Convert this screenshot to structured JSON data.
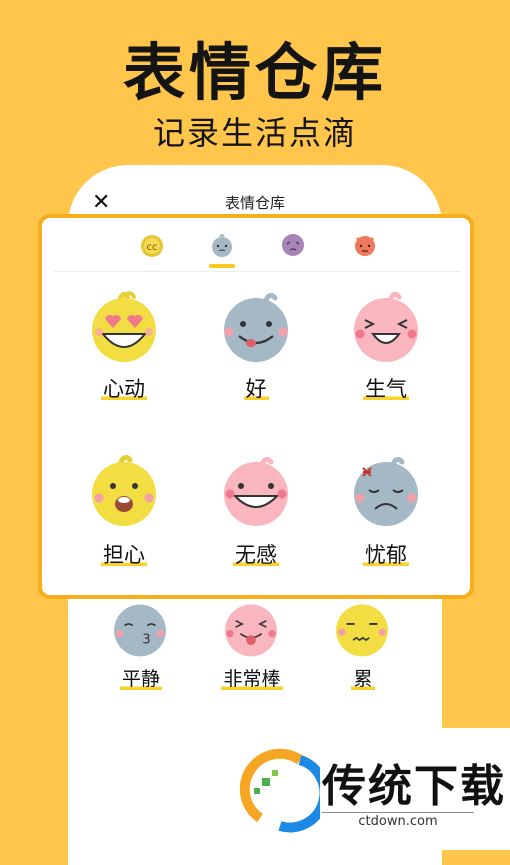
{
  "hero": {
    "title": "表情仓库",
    "subtitle": "记录生活点滴"
  },
  "nav": {
    "title": "表情仓库",
    "close_icon": "close-icon"
  },
  "tabs": [
    {
      "icon": "yellow-face-icon",
      "active": false
    },
    {
      "icon": "blue-face-icon",
      "active": true
    },
    {
      "icon": "purple-face-icon",
      "active": false
    },
    {
      "icon": "red-face-icon",
      "active": false
    }
  ],
  "moods": [
    {
      "label": "心动",
      "color": "#F4DE40"
    },
    {
      "label": "好",
      "color": "#A5B8C6"
    },
    {
      "label": "生气",
      "color": "#FAB6BE"
    },
    {
      "label": "担心",
      "color": "#F4DE40"
    },
    {
      "label": "无感",
      "color": "#FAB6BE"
    },
    {
      "label": "忧郁",
      "color": "#A5B8C6"
    }
  ],
  "more_moods": [
    {
      "label": "平静",
      "color": "#A5B8C6"
    },
    {
      "label": "非常棒",
      "color": "#FAB6BE"
    },
    {
      "label": "累",
      "color": "#F4DE40"
    }
  ],
  "watermark": {
    "name": "传统下载",
    "url": "ctdown.com"
  },
  "colors": {
    "background": "#FFC64B",
    "card_border": "#F6AE1A",
    "highlight": "#F9D32A"
  }
}
